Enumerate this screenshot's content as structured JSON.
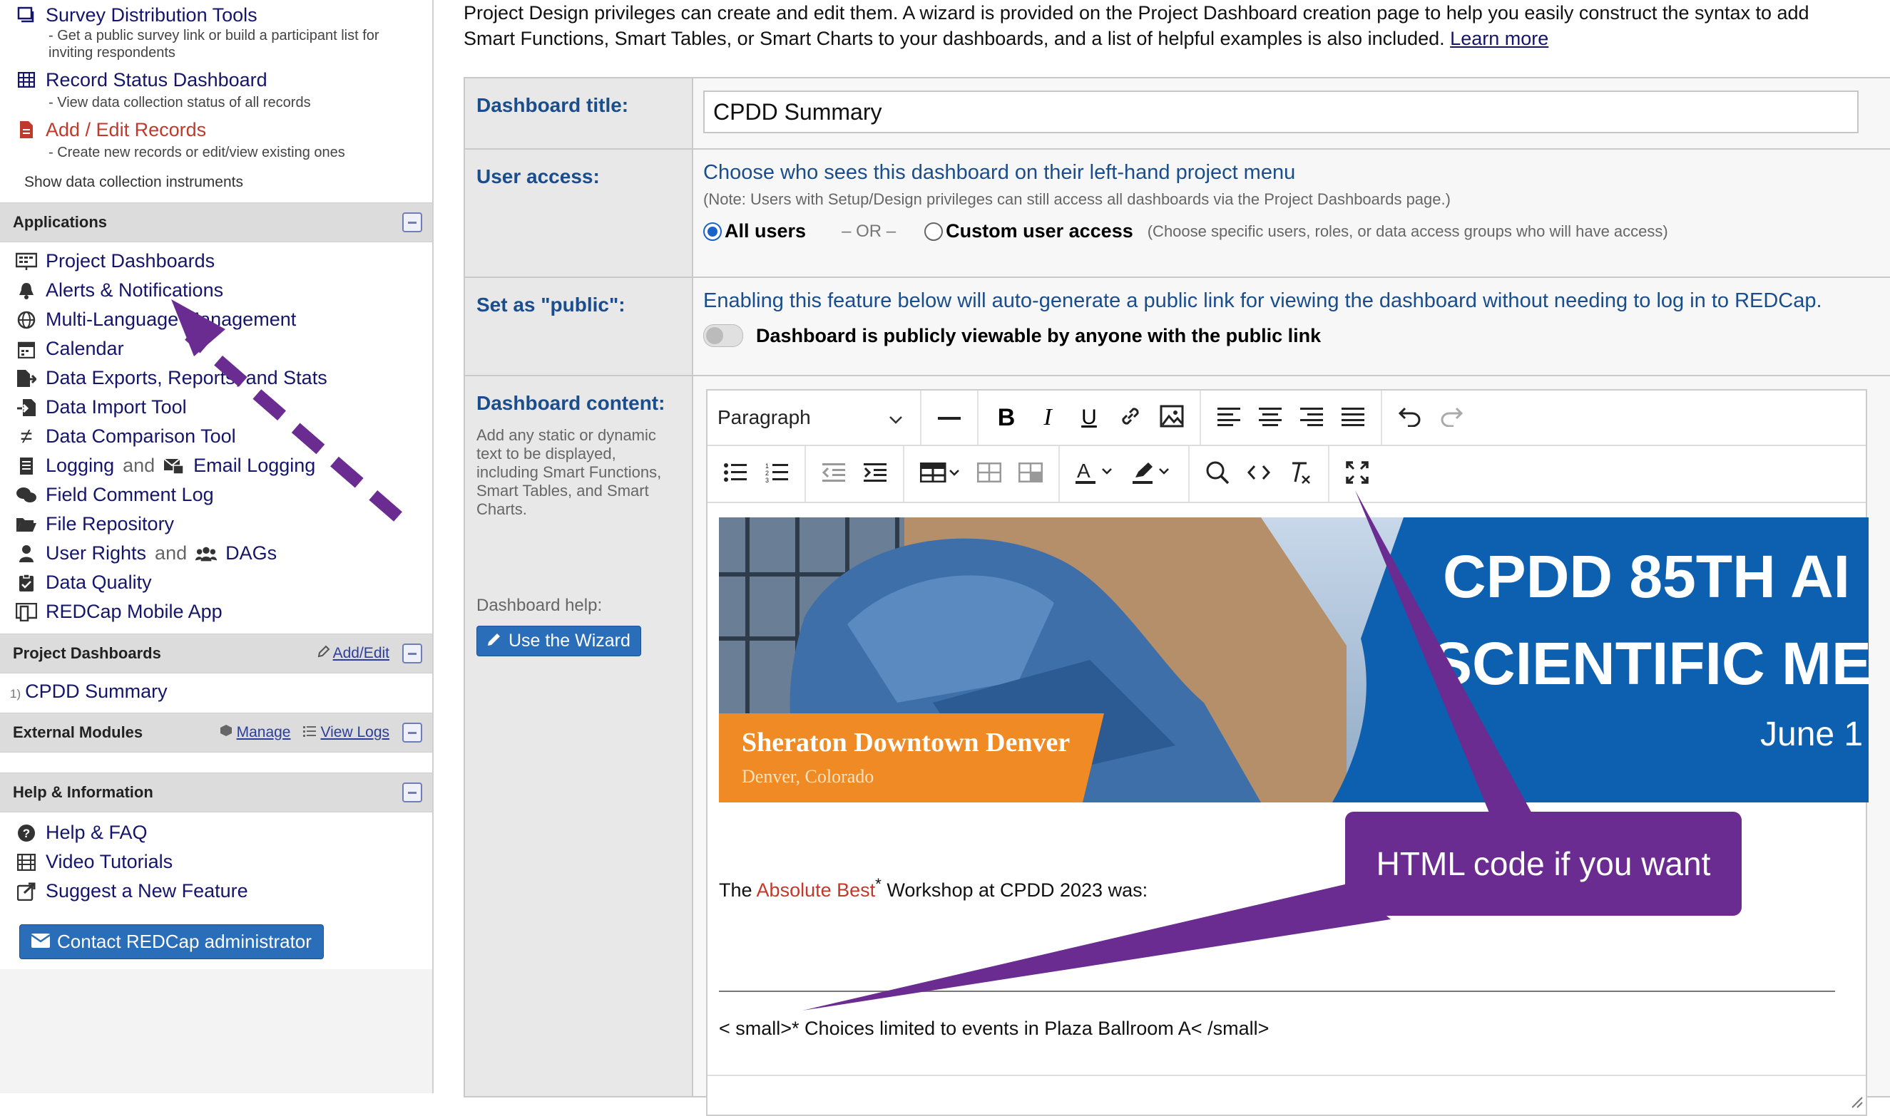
{
  "sidebar": {
    "data_collection": [
      {
        "label": "Survey Distribution Tools",
        "sub": "- Get a public survey link or build a participant list for inviting respondents"
      },
      {
        "label": "Record Status Dashboard",
        "sub": "- View data collection status of all records"
      },
      {
        "label": "Add / Edit Records",
        "sub": "- Create new records or edit/view existing ones"
      }
    ],
    "show_instruments": "Show data collection instruments",
    "applications_header": "Applications",
    "applications": [
      "Project Dashboards",
      "Alerts & Notifications",
      "Multi-Language Management",
      "Calendar",
      "Data Exports, Reports, and Stats",
      "Data Import Tool",
      "Data Comparison Tool",
      "Logging",
      "Field Comment Log",
      "File Repository",
      "User Rights",
      "Data Quality",
      "REDCap Mobile App"
    ],
    "and_label": "and",
    "email_logging": "Email Logging",
    "dags": "DAGs",
    "project_dashboards_header": "Project Dashboards",
    "add_edit": "Add/Edit",
    "dashboard_index": "1)",
    "dashboard_link": "CPDD Summary",
    "external_modules_header": "External Modules",
    "manage": "Manage",
    "view_logs": "View Logs",
    "help_header": "Help & Information",
    "help_items": [
      "Help & FAQ",
      "Video Tutorials",
      "Suggest a New Feature"
    ],
    "contact_button": "Contact REDCap administrator"
  },
  "main": {
    "intro_line1": "Project Design privileges can create and edit them. A wizard is provided on the Project Dashboard creation page to help you easily construct the syntax to add",
    "intro_line2": "Smart Functions, Smart Tables, or Smart Charts to your dashboards, and a list of helpful examples is also included.",
    "learn_more": "Learn more",
    "title_label": "Dashboard title:",
    "title_value": "CPDD Summary",
    "access_label": "User access:",
    "access_heading": "Choose who sees this dashboard on their left-hand project menu",
    "access_note": "(Note: Users with Setup/Design privileges can still access all dashboards via the Project Dashboards page.)",
    "all_users": "All users",
    "or_text": "– OR –",
    "custom_access": "Custom user access",
    "custom_note": "(Choose specific users, roles, or data access groups who will have access)",
    "public_label": "Set as \"public\":",
    "public_heading": "Enabling this feature below will auto-generate a public link for viewing the dashboard without needing to log in to REDCap.",
    "public_toggle_label": "Dashboard is publicly viewable by anyone with the public link",
    "content_label": "Dashboard content:",
    "content_desc": "Add any static or dynamic text to be displayed, including Smart Functions, Smart Tables, and Smart Charts.",
    "help_label": "Dashboard help:",
    "wizard_button": "Use the Wizard"
  },
  "editor": {
    "block_format": "Paragraph",
    "banner_title_line1": "CPDD 85TH AI",
    "banner_title_line2": "SCIENTIFIC ME",
    "banner_date": "June 1",
    "banner_venue": "Sheraton Downtown Denver",
    "banner_city": "Denver, Colorado",
    "line_pre": "The ",
    "line_red": "Absolute Best",
    "line_star": "*",
    "line_post": " Workshop at CPDD 2023 was:",
    "footnote": "< small>* Choices limited to events in Plaza Ballroom A< /small>"
  },
  "annotation": {
    "callout": "HTML code if you want"
  },
  "colors": {
    "link_navy": "#15156b",
    "label_blue": "#1a4d8c",
    "annotation_purple": "#6a2c91",
    "banner_blue": "#0d5fb0",
    "banner_orange": "#f08a24",
    "red_text": "#c0392b"
  }
}
